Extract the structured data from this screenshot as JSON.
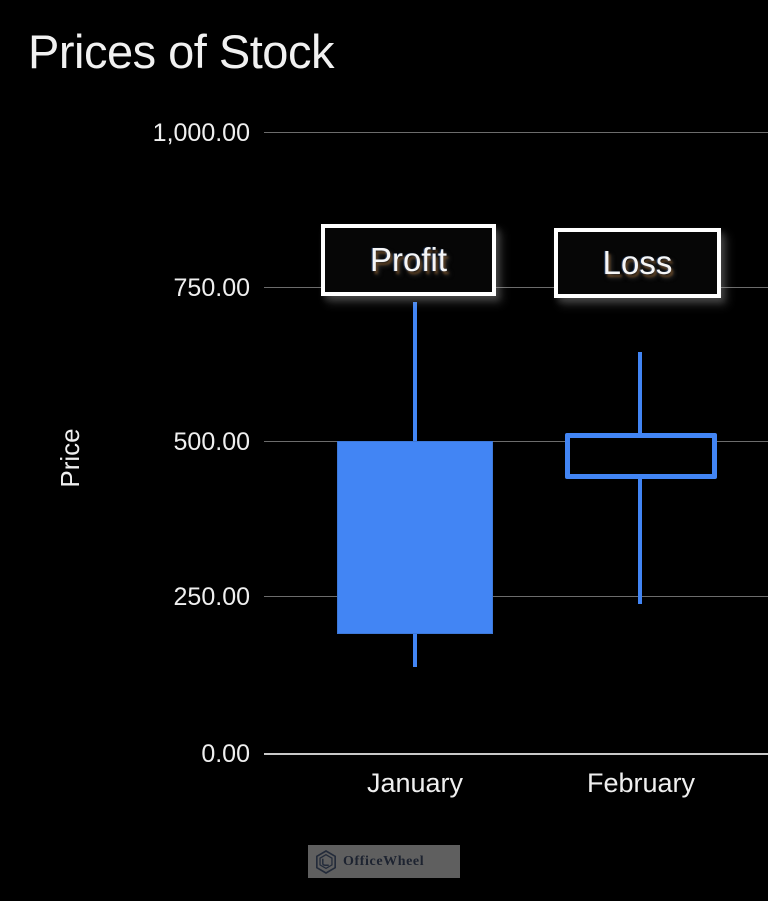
{
  "chart_data": {
    "type": "candlestick",
    "title": "Prices of Stock",
    "xlabel": "",
    "ylabel": "Price",
    "categories": [
      "January",
      "February"
    ],
    "ylim": [
      0,
      1000
    ],
    "ytick_labels": [
      "1,000.00",
      "750.00",
      "500.00",
      "250.00",
      "0.00"
    ],
    "ytick_values": [
      1000,
      750,
      500,
      250,
      0
    ],
    "grid": true,
    "legend": "none",
    "series": [
      {
        "name": "January",
        "label": "Profit",
        "direction": "up",
        "style": "filled",
        "color": "#4285F4",
        "open": 190,
        "close": 500,
        "low": 145,
        "high": 730
      },
      {
        "name": "February",
        "label": "Loss",
        "direction": "down",
        "style": "hollow",
        "color": "#4285F4",
        "open": 512,
        "close": 445,
        "low": 245,
        "high": 650
      }
    ]
  },
  "watermark": {
    "text": "OfficeWheel",
    "icon": "hexagon-logo-icon"
  },
  "colors": {
    "background": "#000000",
    "accent": "#4285F4",
    "gridline": "#6C6C6C",
    "axis": "#C9C9C9",
    "text": "#EFEFEF"
  }
}
